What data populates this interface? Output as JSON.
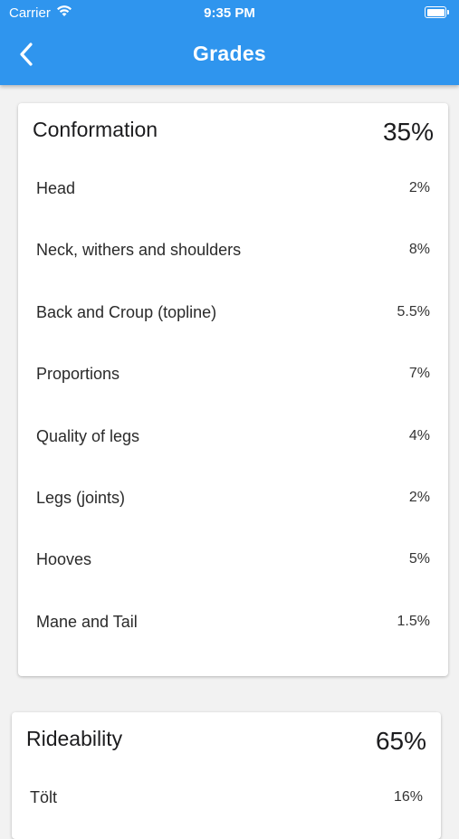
{
  "status_bar": {
    "carrier": "Carrier",
    "time": "9:35 PM"
  },
  "header": {
    "title": "Grades"
  },
  "sections": [
    {
      "title": "Conformation",
      "total": "35%",
      "items": [
        {
          "label": "Head",
          "value": "2%"
        },
        {
          "label": "Neck, withers and shoulders",
          "value": "8%"
        },
        {
          "label": "Back and Croup (topline)",
          "value": "5.5%"
        },
        {
          "label": "Proportions",
          "value": "7%"
        },
        {
          "label": "Quality of legs",
          "value": "4%"
        },
        {
          "label": "Legs (joints)",
          "value": "2%"
        },
        {
          "label": "Hooves",
          "value": "5%"
        },
        {
          "label": "Mane and Tail",
          "value": "1.5%"
        }
      ]
    },
    {
      "title": "Rideability",
      "total": "65%",
      "items": [
        {
          "label": "Tölt",
          "value": "16%"
        }
      ]
    }
  ]
}
